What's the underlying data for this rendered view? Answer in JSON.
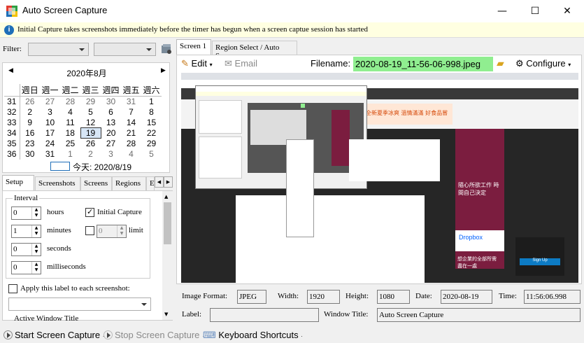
{
  "window": {
    "title": "Auto Screen Capture",
    "minimize": "—",
    "maximize": "☐",
    "close": "✕"
  },
  "info": {
    "text": "Initial Capture takes screenshots immediately before the timer has begun when a screen captue session has started"
  },
  "filter": {
    "label": "Filter:"
  },
  "calendar": {
    "month": "2020年8月",
    "prev": "◀",
    "next": "▶",
    "dows": [
      "週日",
      "週一",
      "週二",
      "週三",
      "週四",
      "週五",
      "週六"
    ],
    "weeks": [
      {
        "wk": "31",
        "days": [
          "26",
          "27",
          "28",
          "29",
          "30",
          "31",
          "1"
        ]
      },
      {
        "wk": "32",
        "days": [
          "2",
          "3",
          "4",
          "5",
          "6",
          "7",
          "8"
        ]
      },
      {
        "wk": "33",
        "days": [
          "9",
          "10",
          "11",
          "12",
          "13",
          "14",
          "15"
        ]
      },
      {
        "wk": "34",
        "days": [
          "16",
          "17",
          "18",
          "19",
          "20",
          "21",
          "22"
        ]
      },
      {
        "wk": "35",
        "days": [
          "23",
          "24",
          "25",
          "26",
          "27",
          "28",
          "29"
        ]
      },
      {
        "wk": "36",
        "days": [
          "30",
          "31",
          "1",
          "2",
          "3",
          "4",
          "5"
        ]
      }
    ],
    "today": "今天: 2020/8/19"
  },
  "left_tabs": [
    "Setup",
    "Screenshots",
    "Screens",
    "Regions",
    "E"
  ],
  "setup": {
    "interval_label": "Interval",
    "hours": "hours",
    "minutes": "minutes",
    "seconds": "seconds",
    "milliseconds": "milliseconds",
    "hours_val": "0",
    "minutes_val": "1",
    "seconds_val": "0",
    "ms_val": "0",
    "initial_capture": "Initial Capture",
    "limit": "limit",
    "limit_val": "0",
    "apply_label": "Apply this label to each screenshot:",
    "active_window_title": "Active Window Title"
  },
  "right_tabs": [
    "Screen 1",
    "Region Select / Auto Save"
  ],
  "toolbar": {
    "edit": "Edit",
    "email": "Email",
    "filename_label": "Filename:",
    "filename": "2020-08-19_11-56-06-998.jpeg",
    "configure": "Configure"
  },
  "details": {
    "image_format_label": "Image Format:",
    "image_format": "JPEG",
    "width_label": "Width:",
    "width": "1920",
    "height_label": "Height:",
    "height": "1080",
    "date_label": "Date:",
    "date": "2020-08-19",
    "time_label": "Time:",
    "time": "11:56:06.998",
    "label_label": "Label:",
    "label": "",
    "window_title_label": "Window Title:",
    "window_title": "Auto Screen Capture"
  },
  "status": {
    "start": "Start Screen Capture",
    "stop": "Stop Screen Capture",
    "shortcuts": "Keyboard Shortcuts"
  },
  "preview": {
    "ad1": "全新夏季冰爽 溫情滿滿 好食品嘗",
    "ad2": "隨心所欲工作 時間自己決定",
    "ad3": "想企業的全部所需 盡在一處",
    "dropbox": "Dropbox",
    "signup": "Sign Up"
  },
  "colors": {
    "accent": "#1f6fb8",
    "filename_bg": "#90ee90",
    "ad": "#7b1d3f"
  }
}
